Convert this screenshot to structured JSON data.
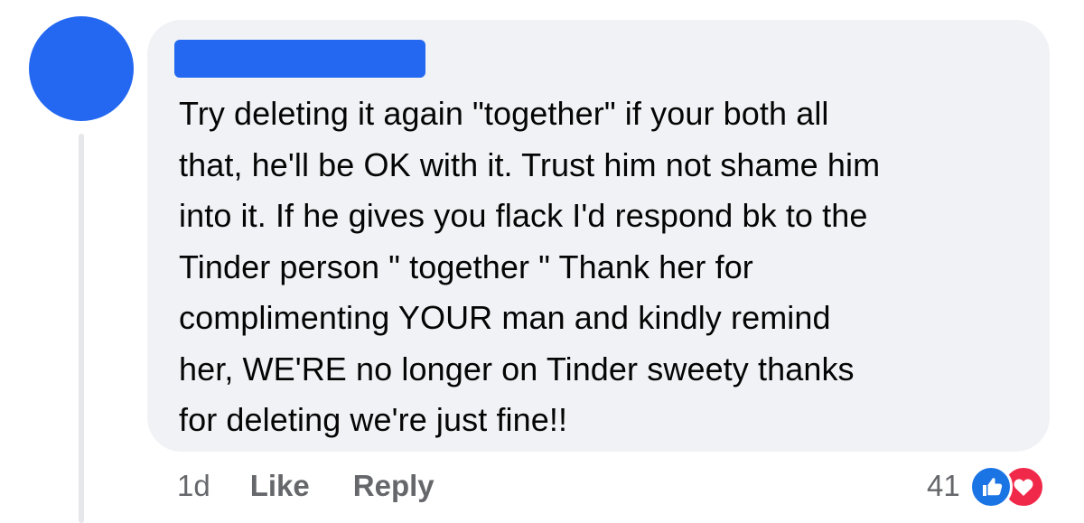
{
  "comment": {
    "author": "",
    "text_lines": [
      "Try deleting it again \"together\" if your both all",
      "that, he'll be OK with it. Trust him not shame him",
      "into it. If he gives you flack I'd respond bk to the",
      "Tinder person \" together \" Thank her for",
      "complimenting YOUR man and kindly remind",
      "her, WE'RE no longer on Tinder sweety thanks",
      "for deleting we're just fine!!"
    ]
  },
  "actions": {
    "timestamp": "1d",
    "like_label": "Like",
    "reply_label": "Reply"
  },
  "reactions": {
    "count": "41",
    "types": [
      "like-icon",
      "love-icon"
    ]
  },
  "colors": {
    "avatar": "#2468f2",
    "redaction": "#2468f2",
    "bubble": "#f0f2f5",
    "like": "#1b74e4",
    "love": "#f0284a",
    "meta_text": "#65676b"
  }
}
